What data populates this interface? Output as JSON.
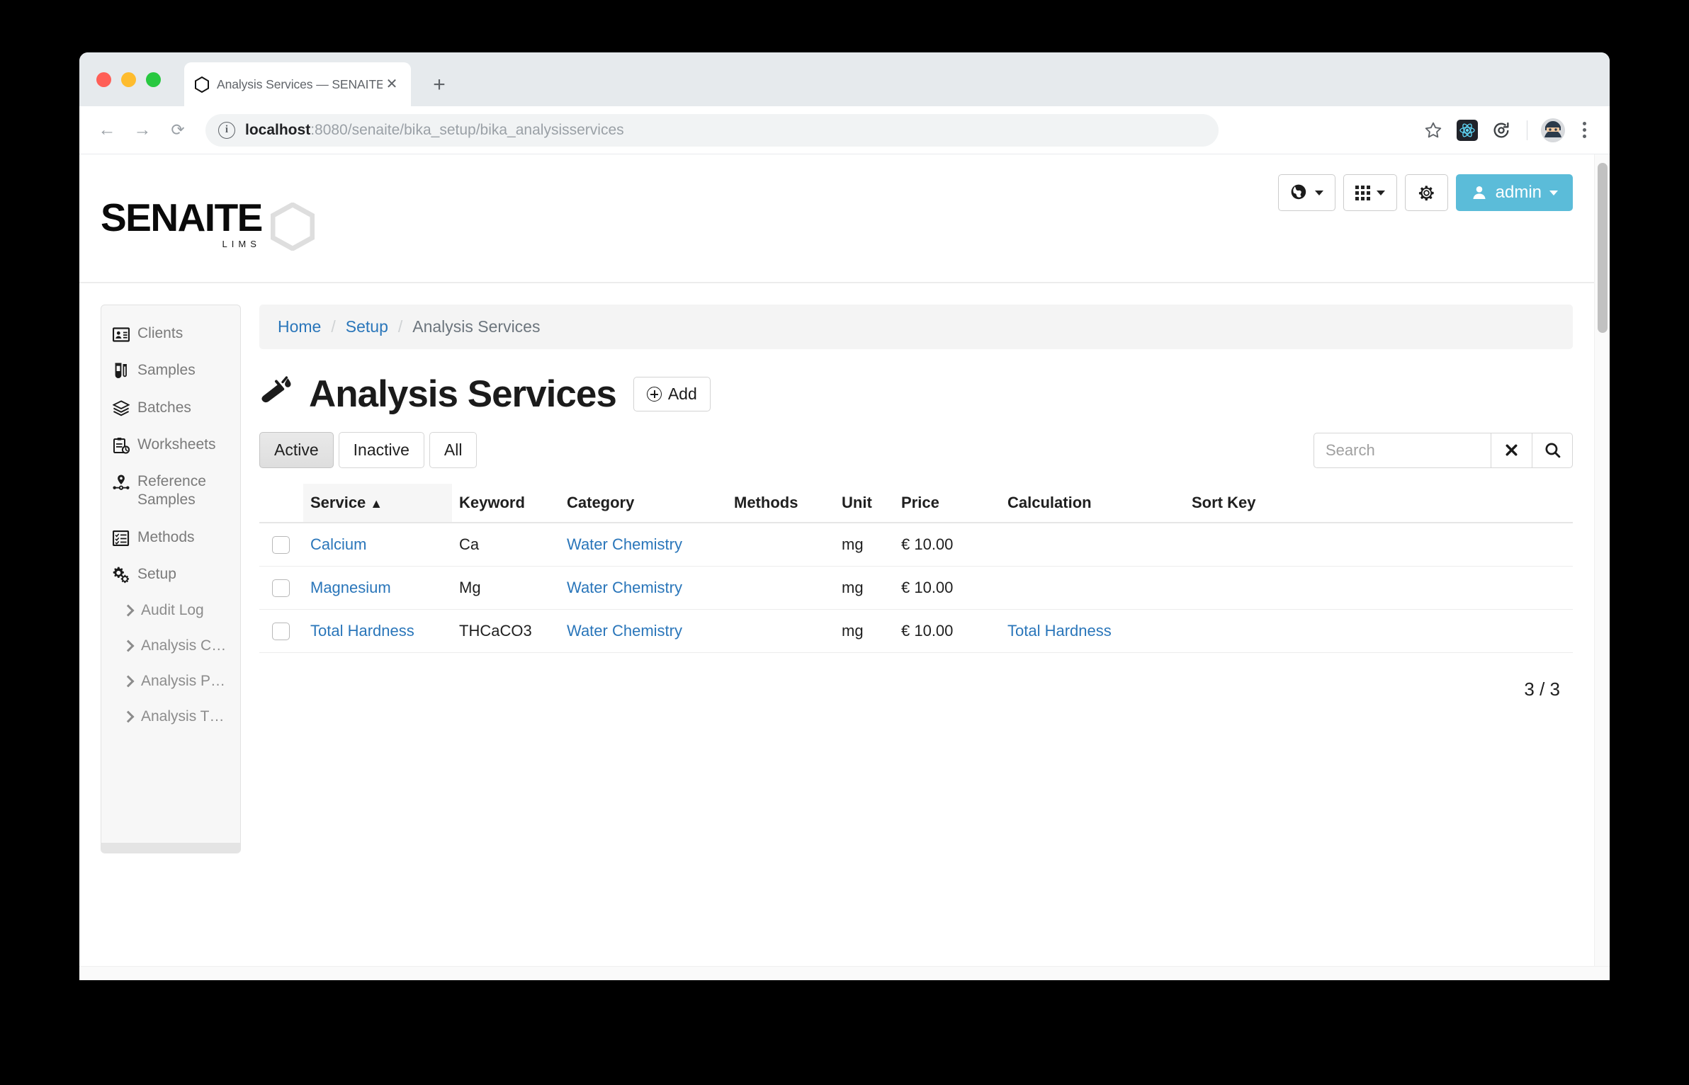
{
  "browser": {
    "tab_title": "Analysis Services — SENAITE",
    "tab_close_glyph": "✕",
    "new_tab_glyph": "+",
    "back_glyph": "←",
    "forward_glyph": "→",
    "reload_glyph": "⟳",
    "url_host": "localhost",
    "url_rest": ":8080/senaite/bika_setup/bika_analysisservices",
    "info_glyph": "i",
    "star_glyph": "☆"
  },
  "header": {
    "logo_text": "SENAITE",
    "logo_sub": "LIMS",
    "admin_label": "admin"
  },
  "sidebar": {
    "items": [
      {
        "label": "Clients",
        "icon": "contact-card-icon"
      },
      {
        "label": "Samples",
        "icon": "test-tube-icon"
      },
      {
        "label": "Batches",
        "icon": "layers-icon"
      },
      {
        "label": "Worksheets",
        "icon": "clipboard-clock-icon"
      },
      {
        "label": "Reference Samples",
        "icon": "map-pin-icon"
      },
      {
        "label": "Methods",
        "icon": "checklist-icon"
      },
      {
        "label": "Setup",
        "icon": "gears-icon"
      }
    ],
    "sub_items": [
      {
        "label": "Audit Log"
      },
      {
        "label": "Analysis C…"
      },
      {
        "label": "Analysis P…"
      },
      {
        "label": "Analysis T…"
      }
    ]
  },
  "breadcrumb": {
    "home": "Home",
    "setup": "Setup",
    "current": "Analysis Services",
    "separator": "/"
  },
  "page": {
    "title": "Analysis Services",
    "add_label": "Add"
  },
  "filters": {
    "tabs": [
      {
        "label": "Active",
        "active": true
      },
      {
        "label": "Inactive",
        "active": false
      },
      {
        "label": "All",
        "active": false
      }
    ]
  },
  "search": {
    "placeholder": "Search",
    "value": "",
    "clear_glyph": "✖",
    "search_glyph": "⌕"
  },
  "table": {
    "columns": [
      {
        "key": "checkbox",
        "label": ""
      },
      {
        "key": "service",
        "label": "Service",
        "sorted": true,
        "sort_arrow": "▲"
      },
      {
        "key": "keyword",
        "label": "Keyword"
      },
      {
        "key": "category",
        "label": "Category"
      },
      {
        "key": "methods",
        "label": "Methods"
      },
      {
        "key": "unit",
        "label": "Unit"
      },
      {
        "key": "price",
        "label": "Price"
      },
      {
        "key": "calculation",
        "label": "Calculation"
      },
      {
        "key": "sortkey",
        "label": "Sort Key"
      }
    ],
    "rows": [
      {
        "service": "Calcium",
        "keyword": "Ca",
        "category": "Water Chemistry",
        "methods": "",
        "unit": "mg",
        "price": "€ 10.00",
        "calculation": "",
        "sortkey": ""
      },
      {
        "service": "Magnesium",
        "keyword": "Mg",
        "category": "Water Chemistry",
        "methods": "",
        "unit": "mg",
        "price": "€ 10.00",
        "calculation": "",
        "sortkey": ""
      },
      {
        "service": "Total Hardness",
        "keyword": "THCaCO3",
        "category": "Water Chemistry",
        "methods": "",
        "unit": "mg",
        "price": "€ 10.00",
        "calculation": "Total Hardness",
        "sortkey": ""
      }
    ],
    "count": "3 / 3"
  },
  "colors": {
    "accent": "#5bbcd9",
    "link": "#2a76ba",
    "tabbar": "#e6eaed",
    "muted_text": "#7a7a7a"
  }
}
